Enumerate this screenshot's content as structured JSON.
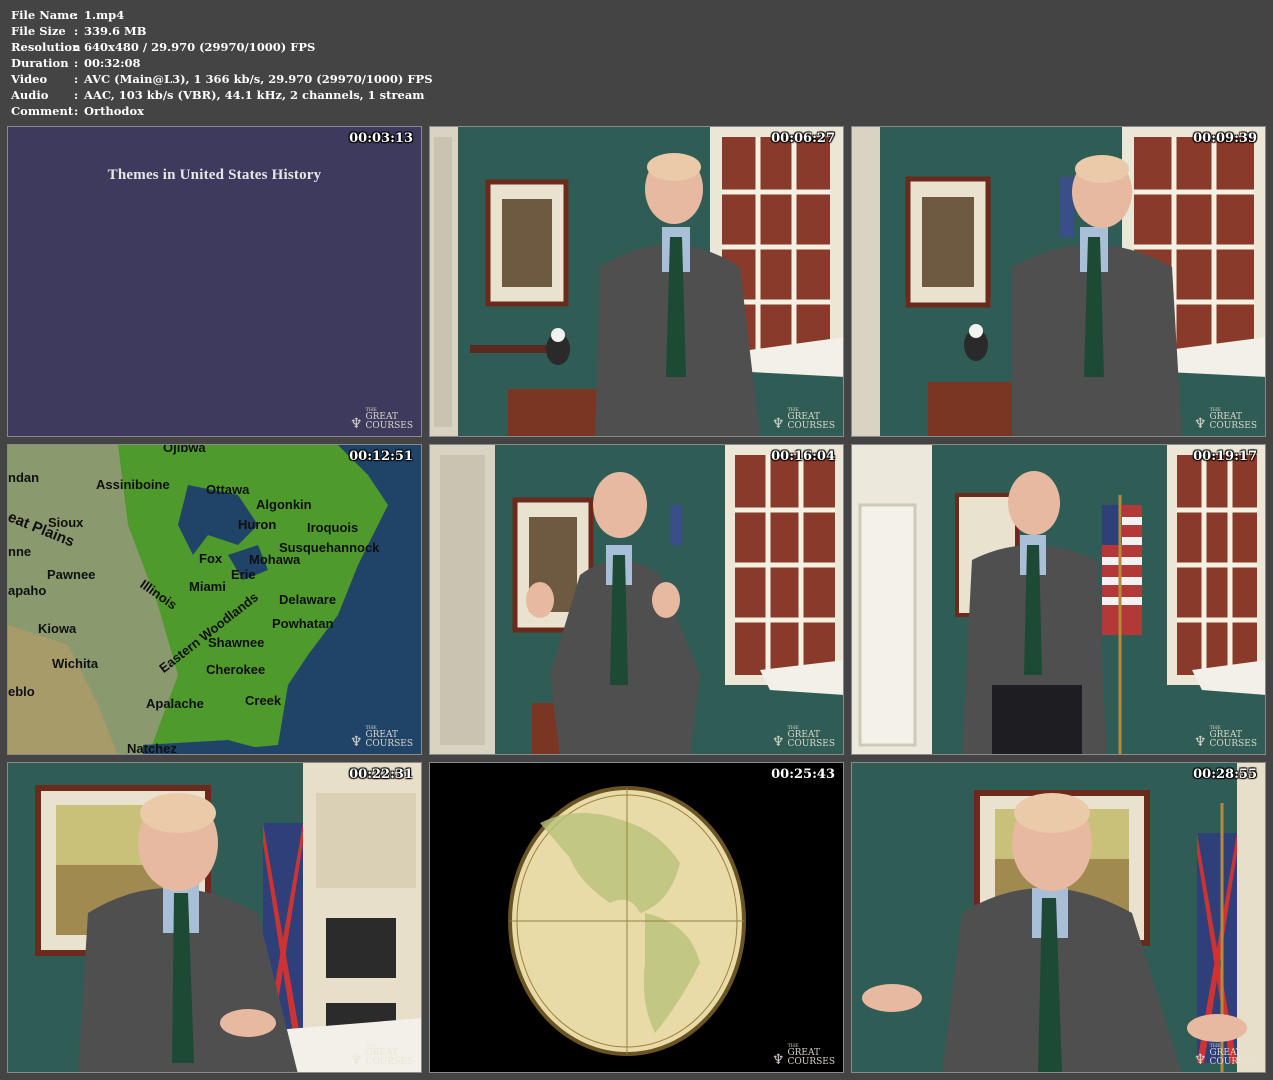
{
  "info": {
    "rows": [
      {
        "key": "File Name",
        "value": "1.mp4"
      },
      {
        "key": "File Size",
        "value": "339.6 MB"
      },
      {
        "key": "Resolution",
        "value": "640x480 / 29.970 (29970/1000) FPS"
      },
      {
        "key": "Duration",
        "value": "00:32:08"
      },
      {
        "key": "Video",
        "value": "AVC (Main@L3), 1 366 kb/s, 29.970 (29970/1000) FPS"
      },
      {
        "key": "Audio",
        "value": "AAC, 103 kb/s (VBR), 44.1 kHz, 2 channels, 1 stream"
      },
      {
        "key": "Comment",
        "value": "Orthodox"
      }
    ],
    "separator": ":"
  },
  "logo": {
    "the": "THE",
    "great": "GREAT",
    "courses": "COURSES"
  },
  "thumbnails": [
    {
      "timestamp": "00:03:13",
      "title": "Themes in United States History"
    },
    {
      "timestamp": "00:06:27"
    },
    {
      "timestamp": "00:09:39"
    },
    {
      "timestamp": "00:12:51"
    },
    {
      "timestamp": "00:16:04"
    },
    {
      "timestamp": "00:19:17"
    },
    {
      "timestamp": "00:22:31"
    },
    {
      "timestamp": "00:25:43"
    },
    {
      "timestamp": "00:28:55"
    }
  ],
  "map_labels": [
    "Ojibwa",
    "ndan",
    "Assiniboine",
    "Ottawa",
    "Algonkin",
    "eat Plains",
    "Sioux",
    "Huron",
    "Iroquois",
    "nne",
    "Susquehannock",
    "Fox",
    "Mohawa",
    "Erie",
    "Pawnee",
    "apaho",
    "Miami",
    "Illinois",
    "Delaware",
    "Eastern Woodlands",
    "Kiowa",
    "Powhatan",
    "Shawnee",
    "Wichita",
    "Cherokee",
    "eblo",
    "Apalache",
    "Creek",
    "Natchez"
  ],
  "colors": {
    "page_background": "#444444",
    "title_card": "#3d3a5e",
    "map_land": "#4f9a2c",
    "map_water": "#1f4468",
    "studio_wall": "#2f5d55",
    "brick": "#8a3a2a"
  }
}
